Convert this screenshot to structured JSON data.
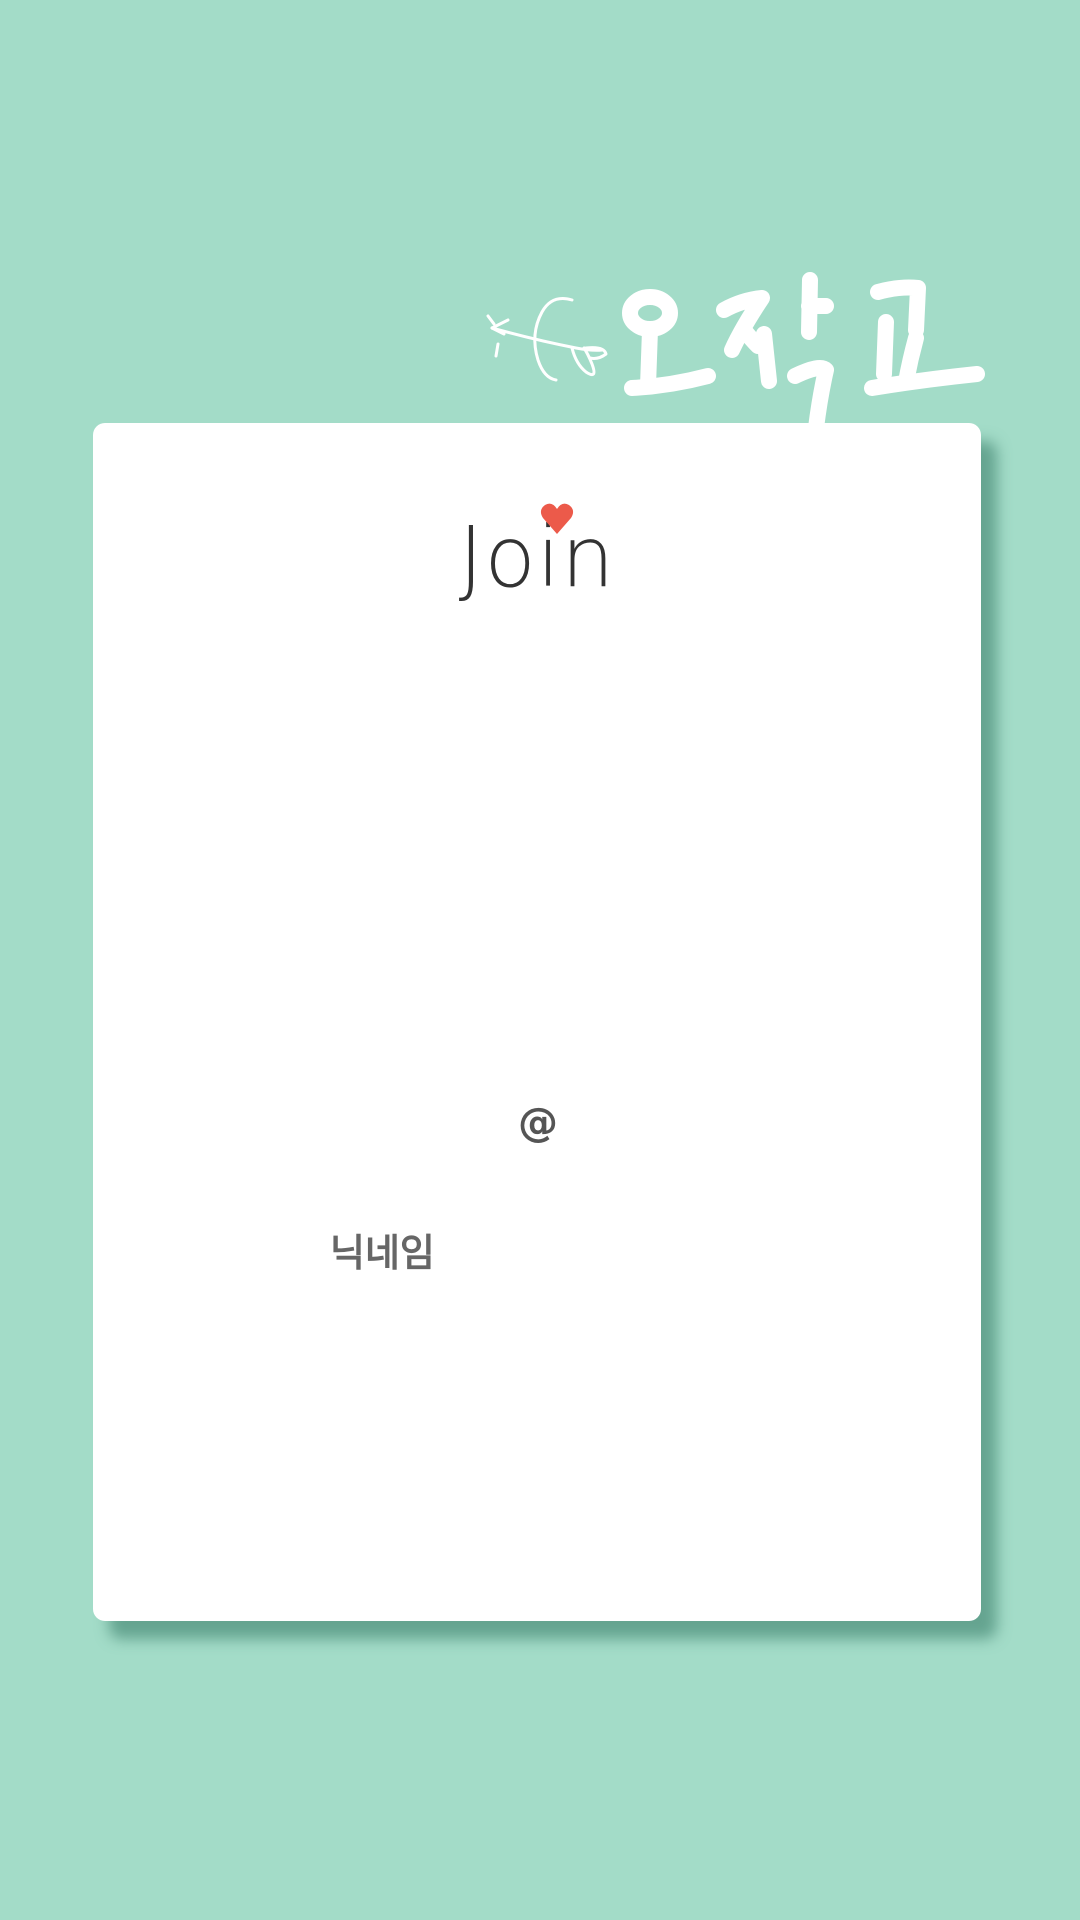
{
  "logo": {
    "text": "오작교",
    "decoration": "arrow-icon"
  },
  "form": {
    "title": "Join",
    "title_accent": "heart-icon",
    "email_separator": "@",
    "nickname_label": "닉네임"
  },
  "colors": {
    "background": "#a3dcc8",
    "card": "#ffffff",
    "heart": "#ec5a4a",
    "title_text": "#333333",
    "label_text": "#666666"
  }
}
